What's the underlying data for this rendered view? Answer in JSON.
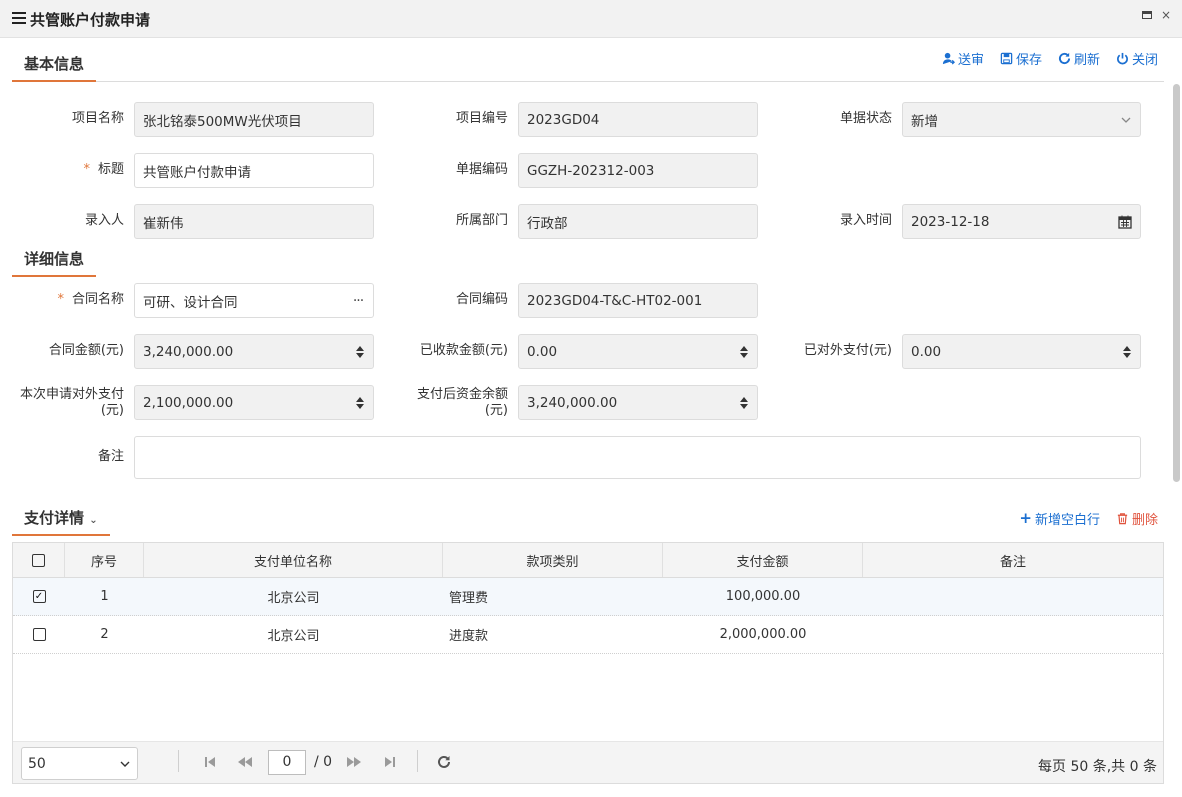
{
  "window": {
    "title": "共管账户付款申请",
    "close_glyph": "×"
  },
  "toolbar": {
    "submit": "送审",
    "save": "保存",
    "refresh": "刷新",
    "close": "关闭"
  },
  "sections": {
    "basic": "基本信息",
    "detail": "详细信息",
    "payment": "支付详情"
  },
  "form": {
    "project_name": {
      "label": "项目名称",
      "value": "张北铭泰500MW光伏项目"
    },
    "project_code": {
      "label": "项目编号",
      "value": "2023GD04"
    },
    "doc_status": {
      "label": "单据状态",
      "value": "新增"
    },
    "title": {
      "label": "标题",
      "value": "共管账户付款申请"
    },
    "doc_code": {
      "label": "单据编码",
      "value": "GGZH-202312-003"
    },
    "entered_by": {
      "label": "录入人",
      "value": "崔新伟"
    },
    "department": {
      "label": "所属部门",
      "value": "行政部"
    },
    "entered_time": {
      "label": "录入时间",
      "value": "2023-12-18"
    },
    "contract_name": {
      "label": "合同名称",
      "value": "可研、设计合同"
    },
    "contract_code": {
      "label": "合同编码",
      "value": "2023GD04-T&C-HT02-001"
    },
    "contract_amount": {
      "label": "合同金额(元)",
      "value": "3,240,000.00"
    },
    "received_amount": {
      "label": "已收款金额(元)",
      "value": "0.00"
    },
    "paid_external": {
      "label": "已对外支付(元)",
      "value": "0.00"
    },
    "apply_amount": {
      "label_1": "本次申请对外支付",
      "label_2": "(元)",
      "value": "2,100,000.00"
    },
    "remaining_amount": {
      "label_1": "支付后资金余额",
      "label_2": "(元)",
      "value": "3,240,000.00"
    },
    "remark": {
      "label": "备注",
      "value": ""
    },
    "required_mark": "*"
  },
  "payment_toolbar": {
    "add_row": "新增空白行",
    "delete": "删除"
  },
  "grid": {
    "columns": [
      "序号",
      "支付单位名称",
      "款项类别",
      "支付金额",
      "备注"
    ],
    "rows": [
      {
        "checked": true,
        "no": "1",
        "unit": "北京公司",
        "category": "管理费",
        "amount": "100,000.00",
        "remark": ""
      },
      {
        "checked": false,
        "no": "2",
        "unit": "北京公司",
        "category": "进度款",
        "amount": "2,000,000.00",
        "remark": ""
      }
    ],
    "check_glyph": "✓"
  },
  "pager": {
    "page_size": "50",
    "current_page": "0",
    "total_pages": "/ 0",
    "info": "每页 50 条,共 0 条"
  }
}
